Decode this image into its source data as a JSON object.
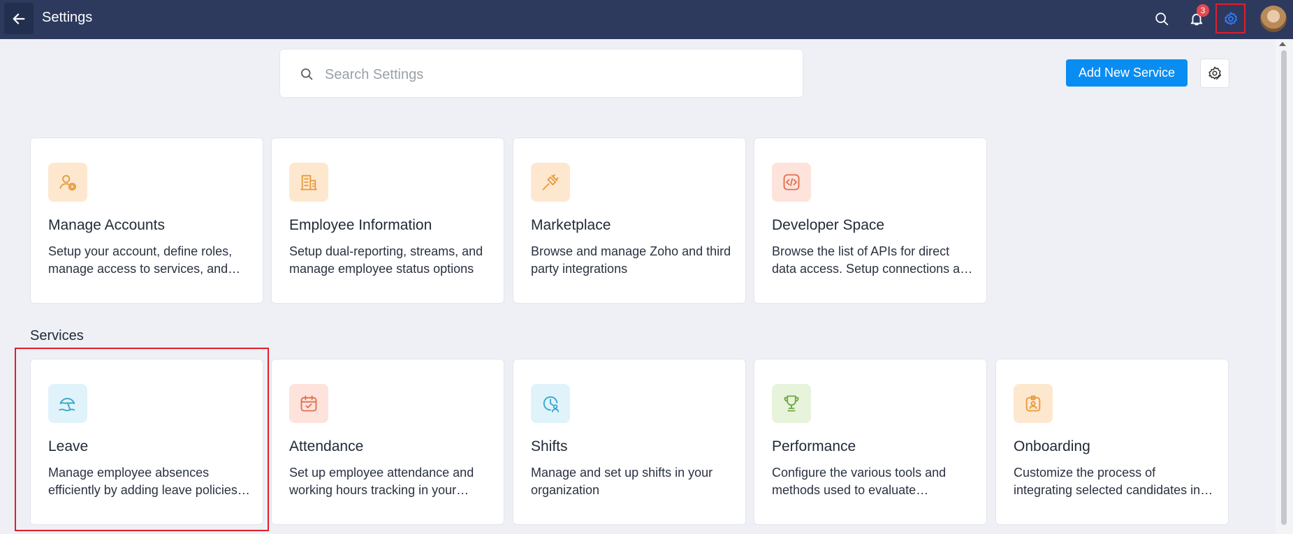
{
  "header": {
    "title": "Settings",
    "notification_count": "3"
  },
  "search": {
    "placeholder": "Search Settings"
  },
  "actions": {
    "add_service_label": "Add New Service"
  },
  "top_cards": [
    {
      "title": "Manage Accounts",
      "description": "Setup your account, define roles, manage access to services, and configure more options",
      "icon": "user-settings-icon",
      "icon_bg": "#fde8cf",
      "icon_color": "#e89a3c"
    },
    {
      "title": "Employee Information",
      "description": "Setup dual-reporting, streams, and manage employee status options",
      "icon": "building-icon",
      "icon_bg": "#fde8cf",
      "icon_color": "#e89a3c"
    },
    {
      "title": "Marketplace",
      "description": "Browse and manage Zoho and third party integrations",
      "icon": "plug-icon",
      "icon_bg": "#fde8cf",
      "icon_color": "#e89a3c"
    },
    {
      "title": "Developer Space",
      "description": "Browse the list of APIs for direct data access. Setup connections and webhooks",
      "icon": "code-icon",
      "icon_bg": "#fde3dc",
      "icon_color": "#e0704f"
    }
  ],
  "services_section": {
    "title": "Services"
  },
  "service_cards": [
    {
      "title": "Leave",
      "description": "Manage employee absences efficiently by adding leave policies and rules",
      "icon": "beach-umbrella-icon",
      "icon_bg": "#e0f3fb",
      "icon_color": "#3aa6cc"
    },
    {
      "title": "Attendance",
      "description": "Set up employee attendance and working hours tracking in your organization",
      "icon": "calendar-check-icon",
      "icon_bg": "#fde3dc",
      "icon_color": "#e0704f"
    },
    {
      "title": "Shifts",
      "description": "Manage and set up shifts in your organization",
      "icon": "clock-user-icon",
      "icon_bg": "#e0f3fb",
      "icon_color": "#3aa6cc"
    },
    {
      "title": "Performance",
      "description": "Configure the various tools and methods used to evaluate performance",
      "icon": "trophy-icon",
      "icon_bg": "#e8f3dc",
      "icon_color": "#6fa83c"
    },
    {
      "title": "Onboarding",
      "description": "Customize the process of integrating selected candidates into your organization",
      "icon": "id-badge-icon",
      "icon_bg": "#fde8cf",
      "icon_color": "#e89a3c"
    }
  ],
  "colors": {
    "topbar": "#2d3a5e",
    "accent": "#0a8df2",
    "highlight": "#e01e2b"
  }
}
